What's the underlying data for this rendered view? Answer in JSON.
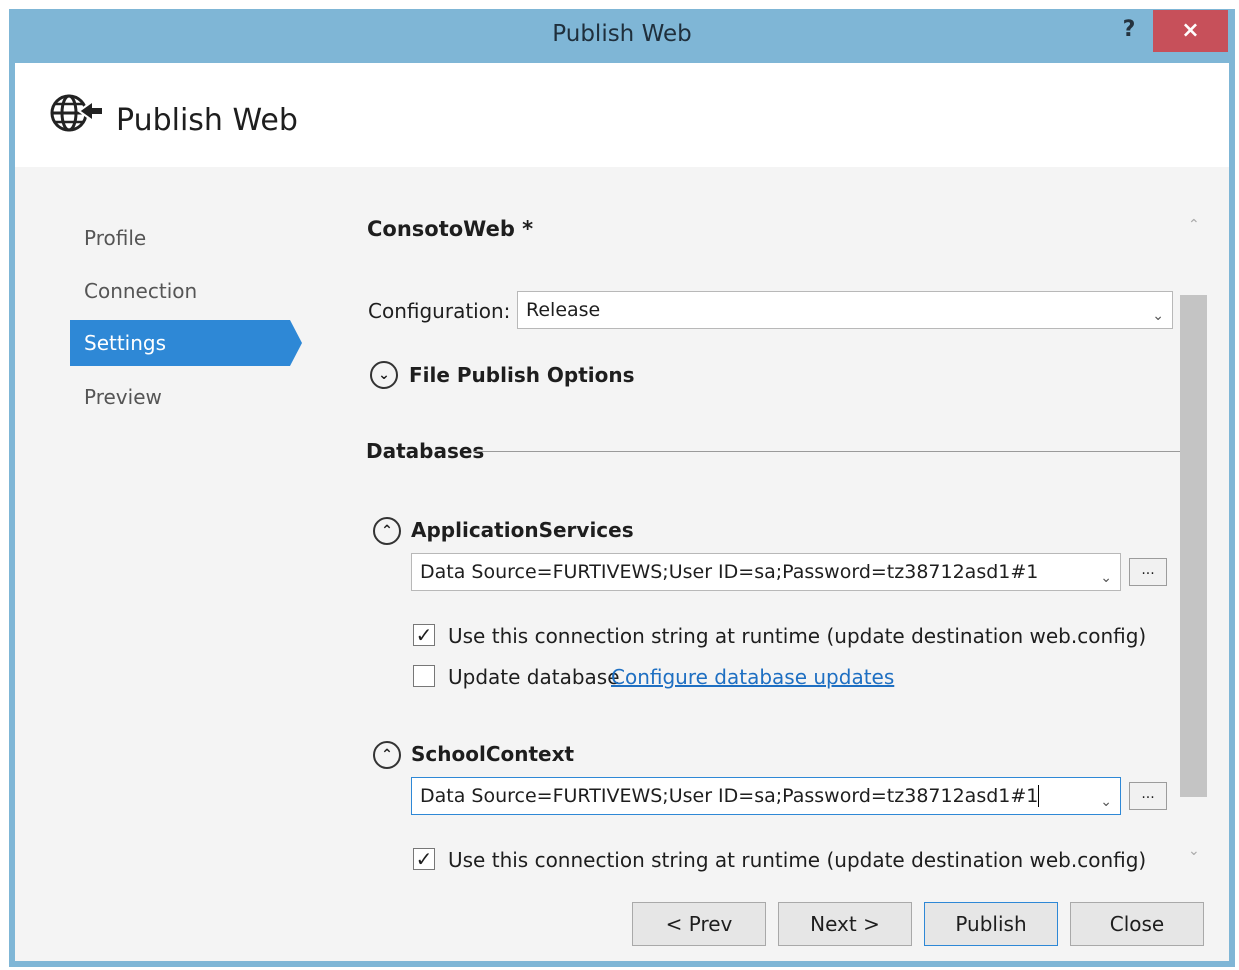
{
  "window": {
    "title": "Publish Web",
    "help": "?",
    "close": "×"
  },
  "header": {
    "title": "Publish Web",
    "icon": "globe-arrow-icon"
  },
  "nav": {
    "items": [
      {
        "label": "Profile"
      },
      {
        "label": "Connection"
      },
      {
        "label": "Settings"
      },
      {
        "label": "Preview"
      }
    ],
    "active": "Settings"
  },
  "profile": {
    "name": "ConsotoWeb *"
  },
  "configuration": {
    "label": "Configuration:",
    "value": "Release"
  },
  "file_publish": {
    "label": "File Publish Options"
  },
  "databases": {
    "label": "Databases",
    "items": [
      {
        "name": "ApplicationServices",
        "connection": "Data Source=FURTIVEWS;User ID=sa;Password=tz38712asd1#1",
        "use_runtime_label": "Use this connection string at runtime (update destination web.config)",
        "use_runtime_checked": true,
        "update_db_label": "Update database",
        "update_db_checked": false,
        "configure_link": "Configure database updates"
      },
      {
        "name": "SchoolContext",
        "connection": "Data Source=FURTIVEWS;User ID=sa;Password=tz38712asd1#1",
        "use_runtime_label": "Use this connection string at runtime (update destination web.config)",
        "use_runtime_checked": true
      }
    ],
    "browse_label": "..."
  },
  "buttons": {
    "prev": "< Prev",
    "next": "Next >",
    "publish": "Publish",
    "close": "Close"
  },
  "colors": {
    "accent": "#2e88d6",
    "frame": "#7fb6d6",
    "close": "#c7505a",
    "link": "#1e6fc2"
  }
}
